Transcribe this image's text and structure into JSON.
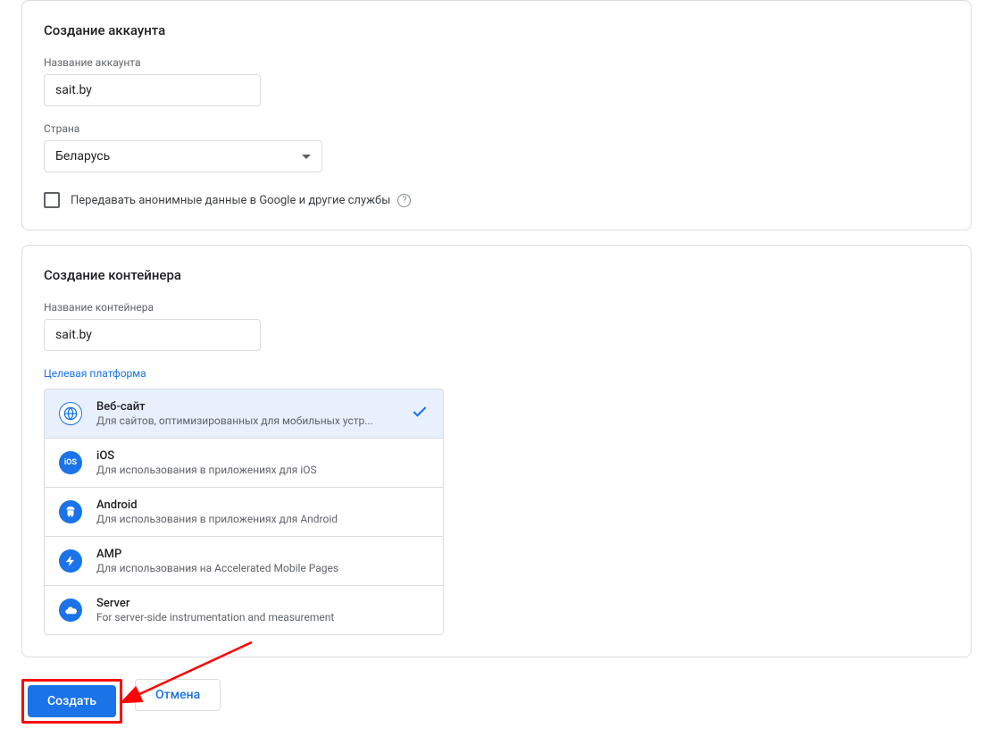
{
  "account": {
    "title": "Создание аккаунта",
    "name_label": "Название аккаунта",
    "name_value": "sait.by",
    "country_label": "Страна",
    "country_value": "Беларусь",
    "share_label": "Передавать анонимные данные в Google и другие службы"
  },
  "container": {
    "title": "Создание контейнера",
    "name_label": "Название контейнера",
    "name_value": "sait.by",
    "platform_label": "Целевая платформа",
    "platforms": [
      {
        "title": "Веб-сайт",
        "desc": "Для сайтов, оптимизированных для мобильных устр...",
        "selected": true
      },
      {
        "title": "iOS",
        "desc": "Для использования в приложениях для iOS",
        "selected": false
      },
      {
        "title": "Android",
        "desc": "Для использования в приложениях для Android",
        "selected": false
      },
      {
        "title": "AMP",
        "desc": "Для использования на Accelerated Mobile Pages",
        "selected": false
      },
      {
        "title": "Server",
        "desc": "For server-side instrumentation and measurement",
        "selected": false
      }
    ]
  },
  "buttons": {
    "create": "Создать",
    "cancel": "Отмена"
  }
}
